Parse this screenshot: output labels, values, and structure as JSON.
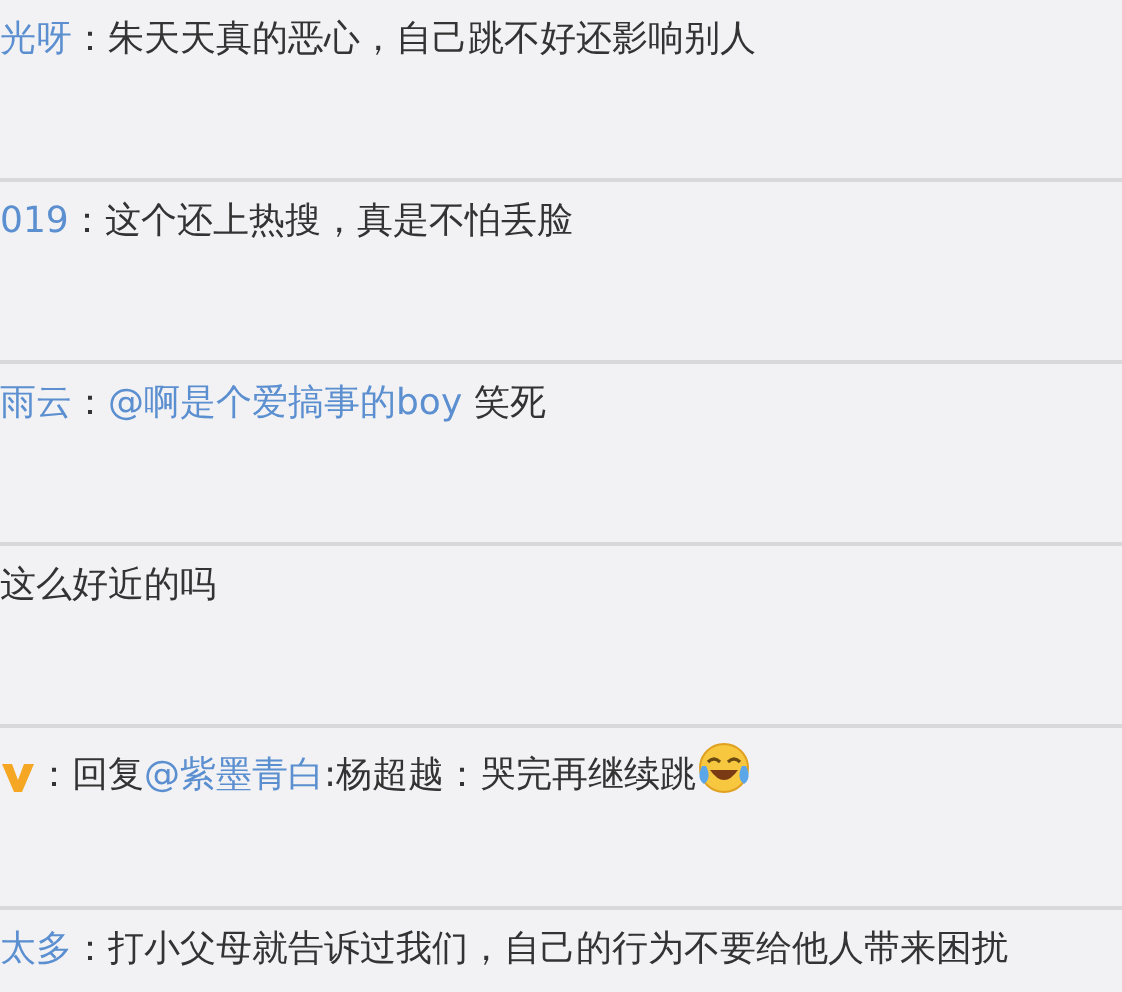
{
  "comments": [
    {
      "user": "光呀",
      "verified": false,
      "parts": [
        {
          "kind": "text",
          "text": "：朱天天真的恶心，自己跳不好还影响别人"
        }
      ]
    },
    {
      "user": "019",
      "verified": false,
      "parts": [
        {
          "kind": "text",
          "text": "：这个还上热搜，真是不怕丢脸"
        }
      ]
    },
    {
      "user": "雨云",
      "verified": false,
      "parts": [
        {
          "kind": "text",
          "text": "："
        },
        {
          "kind": "mention",
          "text": "@啊是个爱搞事的boy"
        },
        {
          "kind": "text",
          "text": " 笑死"
        }
      ]
    },
    {
      "verified": false,
      "parts": [
        {
          "kind": "text",
          "text": "这么好近的吗"
        }
      ]
    },
    {
      "verified": true,
      "parts": [
        {
          "kind": "text",
          "text": "：回复"
        },
        {
          "kind": "mention",
          "text": "@紫墨青白"
        },
        {
          "kind": "text",
          "text": ":杨超越：哭完再继续跳"
        },
        {
          "kind": "emoji"
        }
      ]
    },
    {
      "user": "太多",
      "verified": false,
      "parts": [
        {
          "kind": "text",
          "text": "：打小父母就告诉过我们，自己的行为不要给他人带来困扰"
        }
      ]
    }
  ]
}
